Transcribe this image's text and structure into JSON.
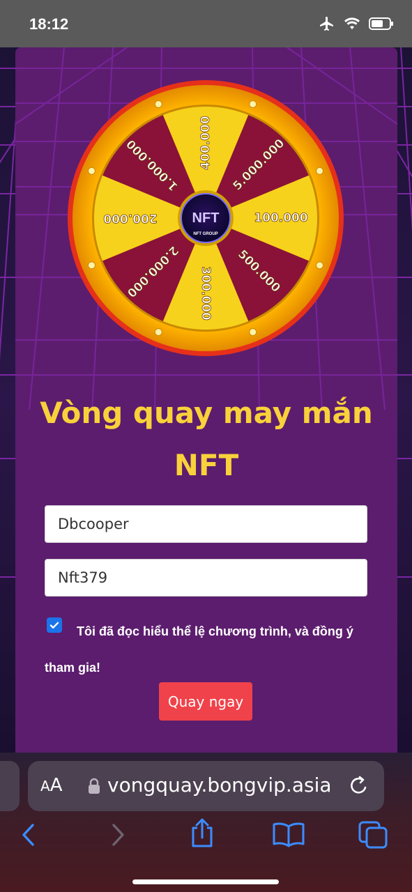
{
  "status_bar": {
    "time": "18:12",
    "icons": [
      "airplane-icon",
      "wifi-icon",
      "battery-icon"
    ]
  },
  "wheel": {
    "logo_text": "NFT",
    "logo_subtitle": "NFT GROUP",
    "segments": [
      "400.000",
      "5.000.000",
      "100.000",
      "500.000",
      "300.000",
      "2.000.000",
      "200.000",
      "1.000.000"
    ]
  },
  "title": {
    "line1": "Vòng quay may mắn",
    "line2": "NFT"
  },
  "form": {
    "name_value": "Dbcooper",
    "code_value": "Nft379",
    "agree_checked": true,
    "agree_text": "Tôi đã đọc hiểu thể lệ chương trình, và đồng ý tham gia!",
    "spin_button": "Quay ngay"
  },
  "browser": {
    "aa_label_small": "A",
    "aa_label_large": "A",
    "url": "vongquay.bongvip.asia",
    "toolbar": [
      "back-icon",
      "forward-icon",
      "share-icon",
      "bookmarks-icon",
      "tabs-icon"
    ]
  },
  "colors": {
    "card_bg": "#5c1d6e",
    "title": "#f9d13a",
    "button": "#f0424a",
    "checkbox": "#1b74ea",
    "wheel_yellow": "#f7d21c",
    "wheel_maroon": "#8a1238",
    "wheel_rim": "#f5a900"
  }
}
